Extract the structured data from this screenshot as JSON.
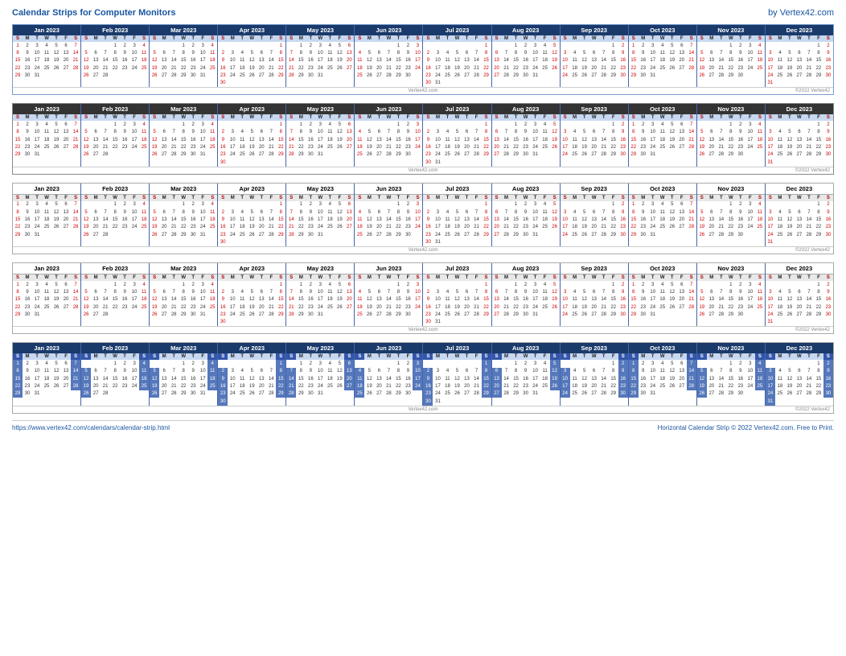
{
  "header": {
    "title": "Calendar Strips for Computer Monitors",
    "brand": "by Vertex42.com"
  },
  "footer": {
    "url": "https://www.vertex42.com/calendars/calendar-strip.html",
    "copyright": "Horizontal Calendar Strip © 2022 Vertex42.com. Free to Print."
  },
  "months": [
    {
      "name": "Jan 2023",
      "startDow": 0,
      "days": 31
    },
    {
      "name": "Feb 2023",
      "startDow": 3,
      "days": 28
    },
    {
      "name": "Mar 2023",
      "startDow": 3,
      "days": 31
    },
    {
      "name": "Apr 2023",
      "startDow": 6,
      "days": 30
    },
    {
      "name": "May 2023",
      "startDow": 1,
      "days": 31
    },
    {
      "name": "Jun 2023",
      "startDow": 4,
      "days": 30
    },
    {
      "name": "Jul 2023",
      "startDow": 6,
      "days": 31
    },
    {
      "name": "Aug 2023",
      "startDow": 2,
      "days": 31
    },
    {
      "name": "Sep 2023",
      "startDow": 5,
      "days": 30
    },
    {
      "name": "Oct 2023",
      "startDow": 0,
      "days": 31
    },
    {
      "name": "Nov 2023",
      "startDow": 3,
      "days": 30
    },
    {
      "name": "Dec 2023",
      "startDow": 5,
      "days": 31
    }
  ],
  "strips": [
    {
      "style": "blue-header",
      "showWatermark": true
    },
    {
      "style": "dark-header",
      "showWatermark": true
    },
    {
      "style": "plain",
      "showWatermark": true
    },
    {
      "style": "plain-border",
      "showWatermark": true
    },
    {
      "style": "colored-weekends",
      "showWatermark": true
    }
  ],
  "watermark": "Vertex42.com",
  "copyright_small": "©2022 Vertex42"
}
